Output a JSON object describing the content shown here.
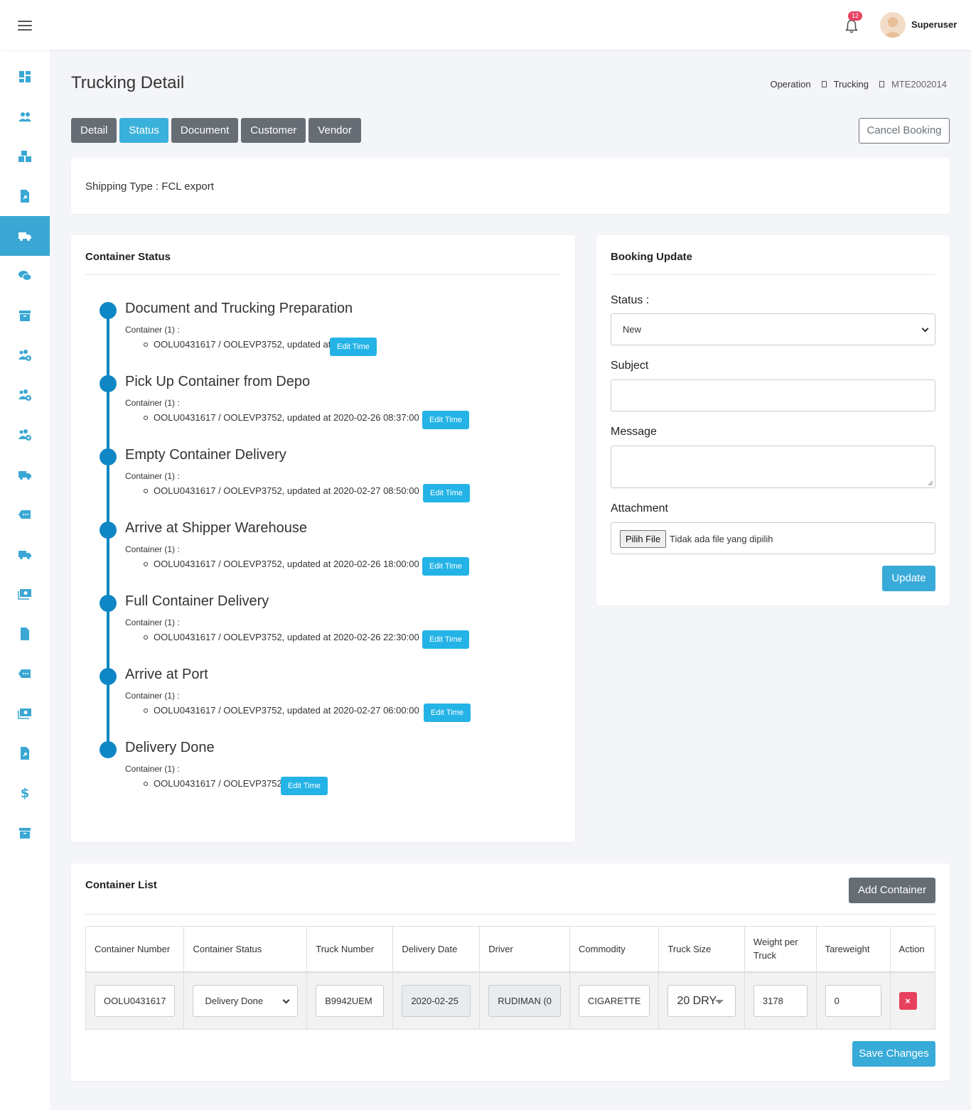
{
  "header": {
    "notification_count": "12",
    "username": "Superuser"
  },
  "page": {
    "title": "Trucking Detail",
    "breadcrumb": [
      "Operation",
      "Trucking",
      "MTE2002014"
    ]
  },
  "tabs": [
    {
      "label": "Detail"
    },
    {
      "label": "Status",
      "active": true
    },
    {
      "label": "Document"
    },
    {
      "label": "Customer"
    },
    {
      "label": "Vendor"
    }
  ],
  "cancel_label": "Cancel Booking",
  "shipping_type": "Shipping Type : FCL export",
  "container_status": {
    "title": "Container Status",
    "container_label": "Container (1) :",
    "edit_label": "Edit Time",
    "steps": [
      {
        "heading": "Document and Trucking Preparation",
        "detail": "OOLU0431617 / OOLEVP3752, updated at"
      },
      {
        "heading": "Pick Up Container from Depo",
        "detail": "OOLU0431617 / OOLEVP3752, updated at 2020-02-26 08:37:00"
      },
      {
        "heading": "Empty Container Delivery",
        "detail": "OOLU0431617 / OOLEVP3752, updated at 2020-02-27 08:50:00"
      },
      {
        "heading": "Arrive at Shipper Warehouse",
        "detail": "OOLU0431617 / OOLEVP3752, updated at 2020-02-26 18:00:00"
      },
      {
        "heading": "Full Container Delivery",
        "detail": "OOLU0431617 / OOLEVP3752, updated at 2020-02-26 22:30:00"
      },
      {
        "heading": "Arrive at Port",
        "detail": "OOLU0431617 / OOLEVP3752, updated at 2020-02-27 06:00:00"
      },
      {
        "heading": "Delivery Done",
        "detail": "OOLU0431617 / OOLEVP3752"
      }
    ]
  },
  "booking_update": {
    "title": "Booking Update",
    "status_label": "Status :",
    "status_value": "New",
    "subject_label": "Subject",
    "message_label": "Message",
    "attachment_label": "Attachment",
    "file_button": "Pilih File",
    "file_placeholder": "Tidak ada file yang dipilih",
    "update_label": "Update"
  },
  "container_list": {
    "title": "Container List",
    "add_label": "Add Container",
    "save_label": "Save Changes",
    "columns": [
      "Container Number",
      "Container Status",
      "Truck Number",
      "Delivery Date",
      "Driver",
      "Commodity",
      "Truck Size",
      "Weight per Truck",
      "Tareweight",
      "Action"
    ],
    "row": {
      "container_number": "OOLU0431617",
      "container_status": "Delivery Done",
      "truck_number": "B9942UEM",
      "delivery_date": "2020-02-25",
      "driver": "RUDIMAN (0",
      "commodity": "CIGARETTE",
      "truck_size": "20 DRY",
      "weight": "3178",
      "tareweight": "0"
    }
  },
  "colors": {
    "accent": "#3ab1da",
    "timeline": "#0f87c4",
    "danger": "#e8415f",
    "secondary": "#666d74"
  }
}
